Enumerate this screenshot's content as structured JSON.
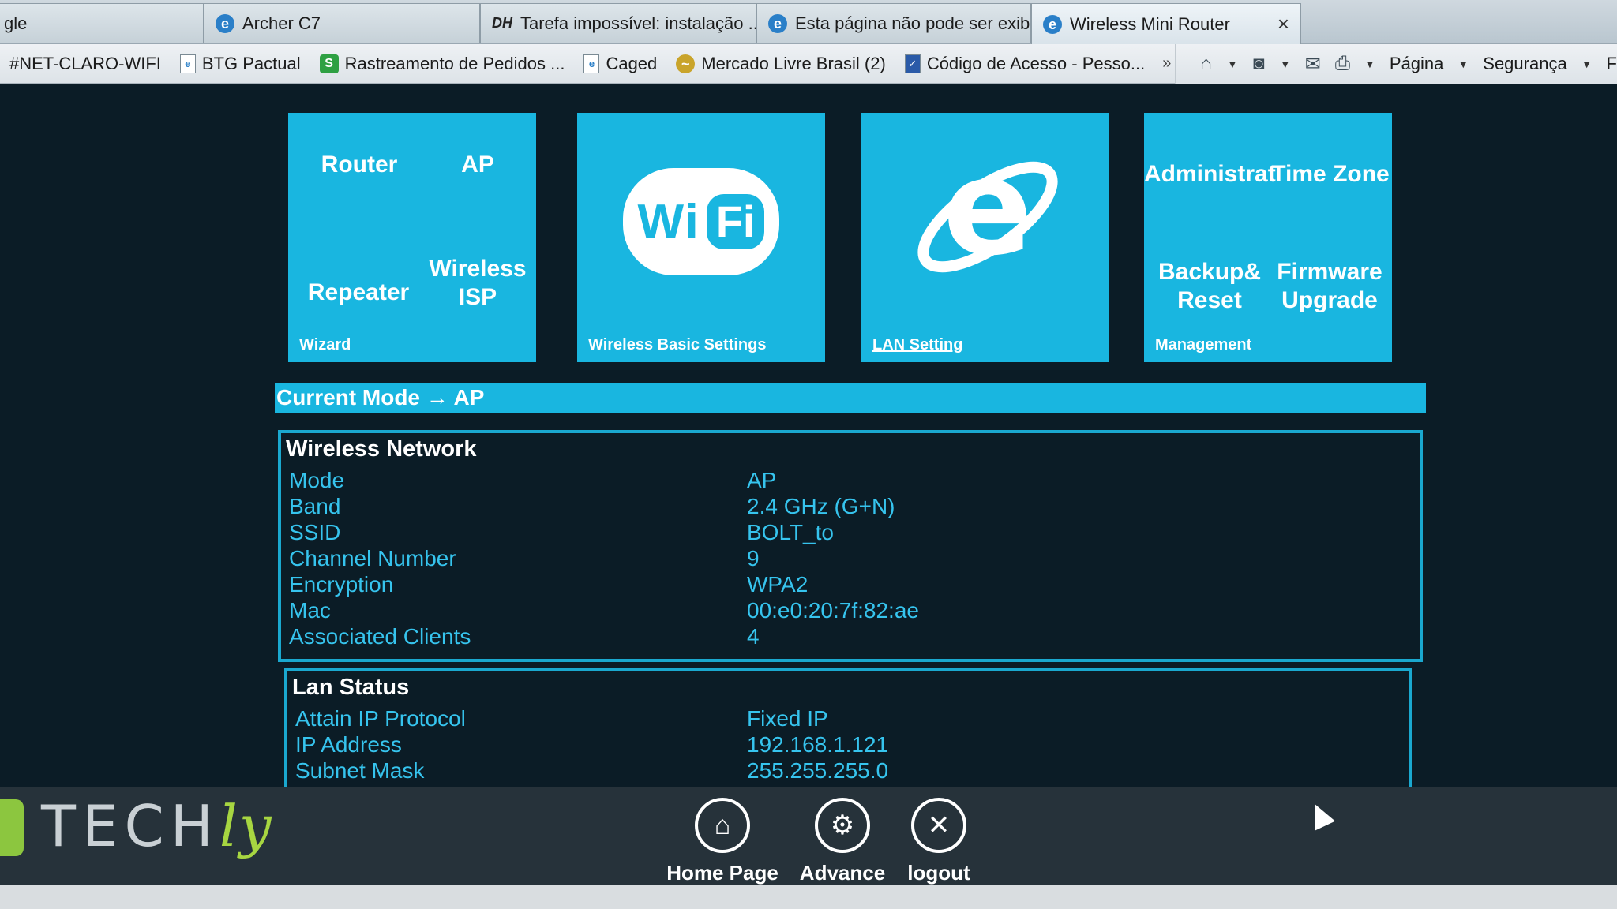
{
  "tabs": [
    {
      "label": "gle"
    },
    {
      "label": "Archer C7"
    },
    {
      "label": "Tarefa impossível: instalação ..."
    },
    {
      "label": "Esta página não pode ser exibi..."
    },
    {
      "label": "Wireless Mini Router",
      "close": "×"
    }
  ],
  "favorites": [
    {
      "label": "#NET-CLARO-WIFI"
    },
    {
      "label": "BTG Pactual"
    },
    {
      "label": "Rastreamento de Pedidos ..."
    },
    {
      "label": "Caged"
    },
    {
      "label": "Mercado Livre Brasil (2)"
    },
    {
      "label": "Código de Acesso - Pesso..."
    }
  ],
  "favorites_more": "»",
  "commandbar": {
    "page": "Página",
    "security": "Segurança",
    "more": "F"
  },
  "tiles": {
    "wizard": {
      "router": "Router",
      "ap": "AP",
      "repeater": "Repeater",
      "wisp": "Wireless\nISP",
      "caption": "Wizard"
    },
    "wireless": {
      "wi": "Wi",
      "fi": "Fi",
      "caption": "Wireless Basic Settings"
    },
    "lan": {
      "glyph": "e",
      "caption": "LAN Setting"
    },
    "management": {
      "admin": "Administrat",
      "timezone": "Time Zone",
      "backup": "Backup&\nReset",
      "firmware": "Firmware\nUpgrade",
      "caption": "Management"
    }
  },
  "current_mode": "Current Mode → AP",
  "wireless_network": {
    "title": "Wireless Network",
    "rows": [
      {
        "k": "Mode",
        "v": "AP"
      },
      {
        "k": "Band",
        "v": "2.4 GHz (G+N)"
      },
      {
        "k": "SSID",
        "v": "BOLT_to"
      },
      {
        "k": "Channel Number",
        "v": "9"
      },
      {
        "k": "Encryption",
        "v": "WPA2"
      },
      {
        "k": "Mac",
        "v": "00:e0:20:7f:82:ae"
      },
      {
        "k": "Associated Clients",
        "v": "4"
      }
    ]
  },
  "lan_status": {
    "title": "Lan Status",
    "rows": [
      {
        "k": "Attain IP Protocol",
        "v": "Fixed IP"
      },
      {
        "k": "IP Address",
        "v": "192.168.1.121"
      },
      {
        "k": "Subnet Mask",
        "v": "255.255.255.0"
      }
    ]
  },
  "footer": {
    "logo": "TECH",
    "logo_suffix": "ly",
    "nav": [
      {
        "label": "Home Page",
        "icon": "home-icon"
      },
      {
        "label": "Advance",
        "icon": "gear-icon"
      },
      {
        "label": "logout",
        "icon": "close-icon"
      }
    ]
  },
  "colors": {
    "accent": "#19b6e0",
    "background": "#0b1c26",
    "text_value": "#36c4ee",
    "logo_green": "#a7d641"
  }
}
